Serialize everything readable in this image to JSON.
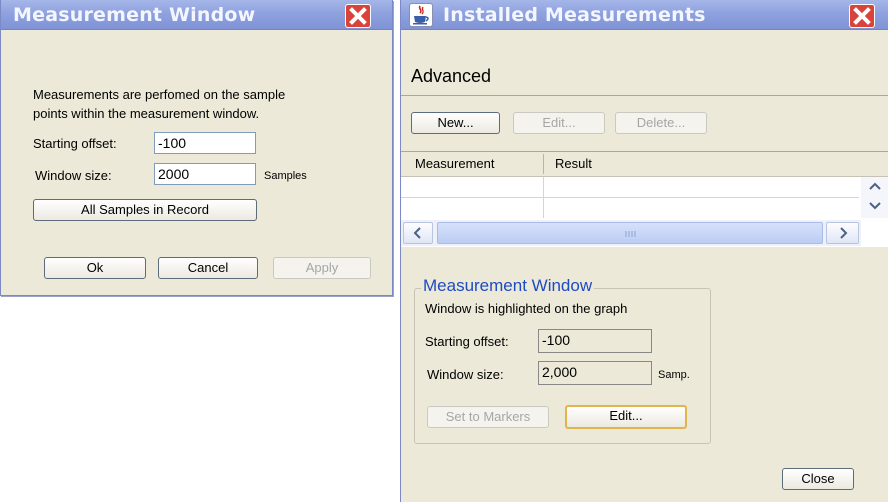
{
  "left_window": {
    "title": "Measurement Window",
    "description_line1": "Measurements are perfomed on the sample",
    "description_line2": "points within the measurement window.",
    "starting_offset_label": "Starting offset:",
    "starting_offset_value": "-100",
    "window_size_label": "Window size:",
    "window_size_value": "2000",
    "window_size_unit": "Samples",
    "all_samples_button": "All Samples in Record",
    "ok_button": "Ok",
    "cancel_button": "Cancel",
    "apply_button": "Apply"
  },
  "right_window": {
    "title": "Installed Measurements",
    "icon": "java-cup-icon",
    "section_title": "Advanced",
    "new_button": "New...",
    "edit_button": "Edit...",
    "delete_button": "Delete...",
    "table": {
      "columns": [
        "Measurement",
        "Result"
      ],
      "rows": [
        [
          "",
          ""
        ],
        [
          "",
          ""
        ]
      ]
    },
    "group": {
      "title": "Measurement Window",
      "subtitle": "Window is highlighted on the graph",
      "starting_offset_label": "Starting offset:",
      "starting_offset_value": "-100",
      "window_size_label": "Window size:",
      "window_size_value": "2,000",
      "window_size_unit": "Samp.",
      "set_to_markers_button": "Set to Markers",
      "edit_button": "Edit..."
    },
    "close_button": "Close"
  },
  "colors": {
    "titlebar": "#8fa2df",
    "dialog_bg": "#ece9d8",
    "close_red": "#d9433a",
    "group_title_blue": "#1e4bc4"
  }
}
